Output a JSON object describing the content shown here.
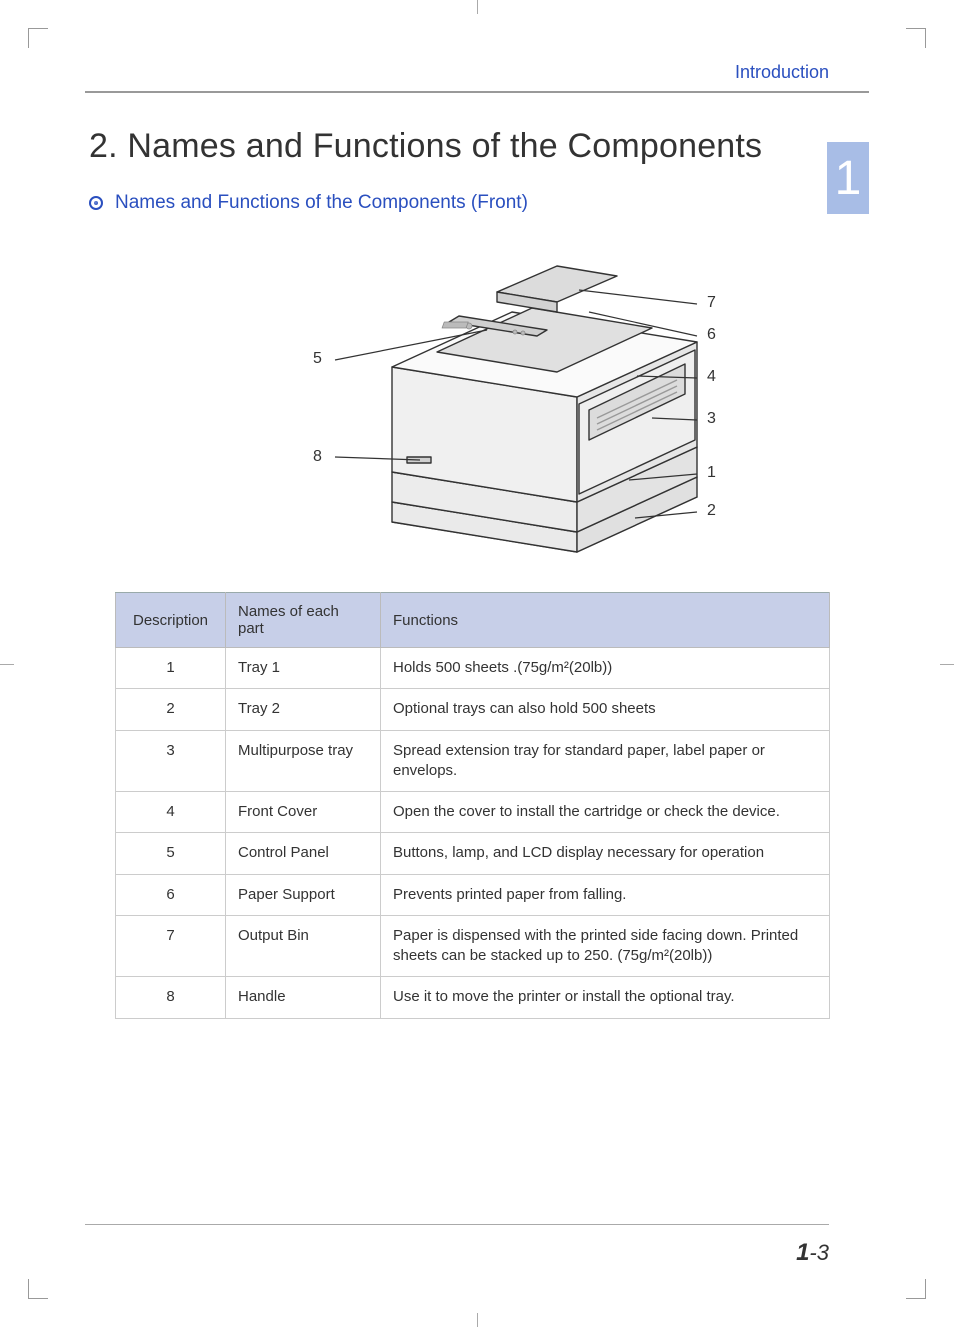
{
  "header": {
    "section": "Introduction"
  },
  "chapter_tab": "1",
  "title": "2. Names and Functions of the Components",
  "subheading": "Names and Functions of the Components (Front)",
  "diagram": {
    "callouts": {
      "c1": "1",
      "c2": "2",
      "c3": "3",
      "c4": "4",
      "c5": "5",
      "c6": "6",
      "c7": "7",
      "c8": "8"
    }
  },
  "table": {
    "headers": {
      "desc": "Description",
      "name": "Names of each part",
      "func": "Functions"
    },
    "rows": [
      {
        "desc": "1",
        "name": "Tray 1",
        "func": "Holds 500 sheets .(75g/m²(20lb))"
      },
      {
        "desc": "2",
        "name": "Tray 2",
        "func": "Optional trays can also hold 500 sheets"
      },
      {
        "desc": "3",
        "name": "Multipurpose tray",
        "func": "Spread extension tray for standard paper, label paper or envelops."
      },
      {
        "desc": "4",
        "name": "Front Cover",
        "func": "Open the cover to install the cartridge or check the device."
      },
      {
        "desc": "5",
        "name": "Control Panel",
        "func": "Buttons, lamp, and LCD display necessary for operation"
      },
      {
        "desc": "6",
        "name": "Paper Support",
        "func": "Prevents printed paper from falling."
      },
      {
        "desc": "7",
        "name": "Output Bin",
        "func": "Paper is dispensed with the printed side facing down. Printed sheets can be stacked up to 250. (75g/m²(20lb))"
      },
      {
        "desc": "8",
        "name": "Handle",
        "func": "Use it to move the printer or install the optional tray."
      }
    ]
  },
  "footer": {
    "chapter": "1",
    "sep": "-",
    "page": "3"
  }
}
